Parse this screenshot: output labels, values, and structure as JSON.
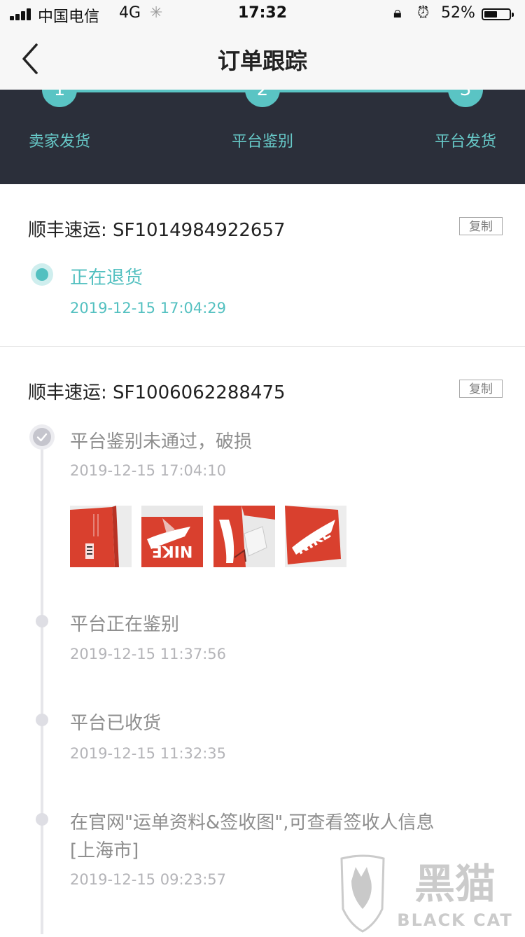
{
  "status_bar": {
    "carrier": "中国电信",
    "network": "4G",
    "time": "17:32",
    "battery_percent": "52%",
    "battery_level": 0.52
  },
  "nav": {
    "title": "订单跟踪"
  },
  "steps": [
    {
      "number": "1",
      "label": "卖家发货"
    },
    {
      "number": "2",
      "label": "平台鉴别"
    },
    {
      "number": "3",
      "label": "平台发货"
    }
  ],
  "shipments": [
    {
      "tracking": "顺丰速运: SF1014984922657",
      "copy_label": "复制",
      "events": [
        {
          "title": "正在退货",
          "time": "2019-12-15 17:04:29"
        }
      ]
    },
    {
      "tracking": "顺丰速运: SF1006062288475",
      "copy_label": "复制",
      "events": [
        {
          "title": "平台鉴别未通过，破损",
          "time": "2019-12-15 17:04:10"
        },
        {
          "title": "平台正在鉴别",
          "time": "2019-12-15 11:37:56"
        },
        {
          "title": "平台已收货",
          "time": "2019-12-15 11:32:35"
        },
        {
          "title_line1": "在官网\"运单资料&签收图\",可查看签收人信息",
          "title_line2": "[上海市]",
          "time": "2019-12-15 09:23:57"
        }
      ]
    }
  ],
  "watermark": {
    "cn": "黑猫",
    "en": "BLACK CAT"
  },
  "colors": {
    "accent": "#5ac4c4",
    "stepper_bg": "#2b2f3a",
    "shoebox_red": "#d9402e"
  }
}
